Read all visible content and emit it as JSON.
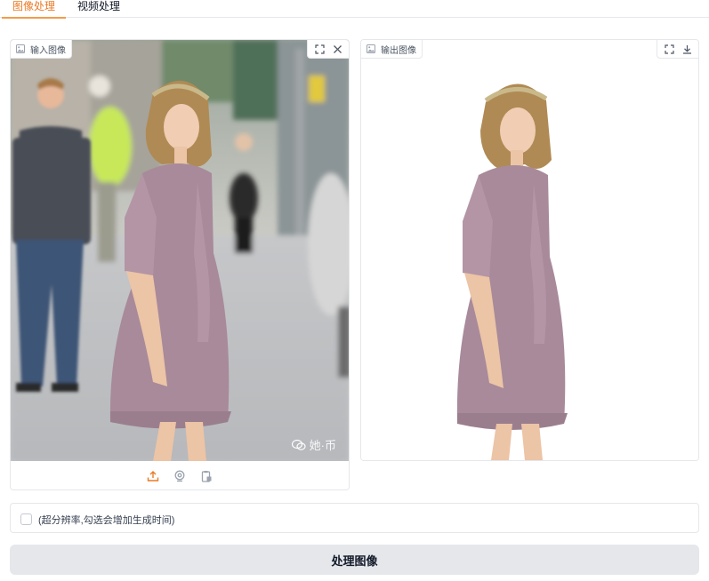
{
  "tabs": [
    {
      "label": "图像处理",
      "active": true
    },
    {
      "label": "视频处理",
      "active": false
    }
  ],
  "input_panel": {
    "label": "输入图像",
    "label_icon": "image-icon",
    "tools": [
      "fullscreen-icon",
      "close-icon"
    ],
    "watermark": "她·币",
    "watermark_icon": "wechat-icon",
    "source_buttons": [
      "upload-icon",
      "webcam-icon",
      "clipboard-icon"
    ]
  },
  "output_panel": {
    "label": "输出图像",
    "label_icon": "image-icon",
    "tools": [
      "fullscreen-icon",
      "download-icon"
    ]
  },
  "options": {
    "super_resolution_label": "(超分辨率,勾选会增加生成时间)",
    "super_resolution_checked": false
  },
  "process_button": {
    "label": "处理图像"
  },
  "colors": {
    "accent": "#ea7a25",
    "button_bg": "#e5e7eb",
    "border": "#e5e7eb"
  }
}
